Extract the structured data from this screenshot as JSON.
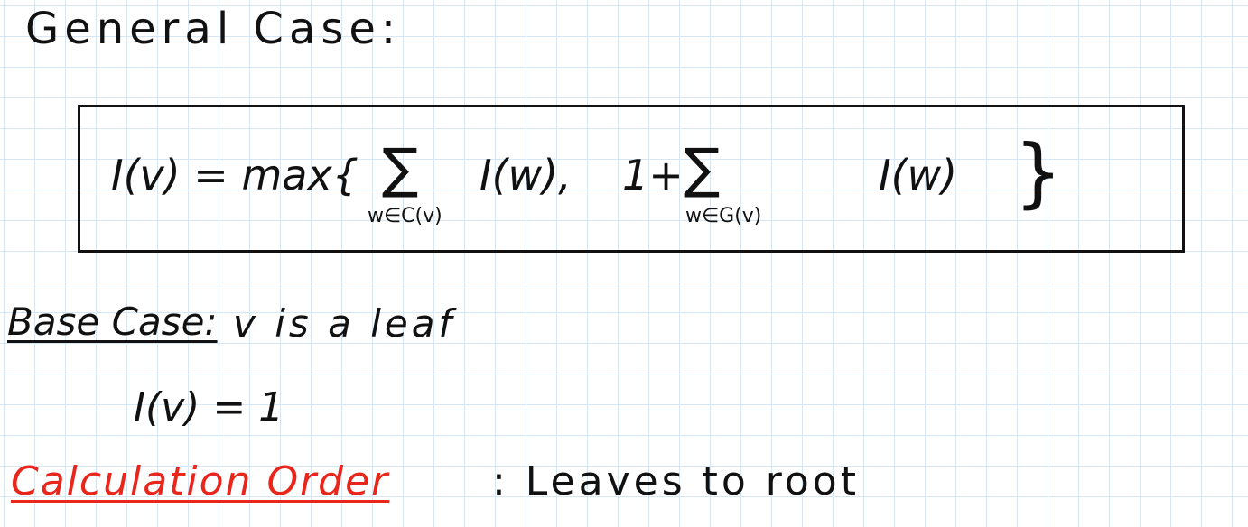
{
  "note": {
    "heading": "General Case:",
    "formula": {
      "lhs": "I(v) = max{",
      "sum1_sub": "w∈C(v)",
      "term1": "I(w),",
      "plus": "1+",
      "sum2_sub": "w∈G(v)",
      "term2": "I(w)",
      "close": "}"
    },
    "base_case_label": "Base Case:",
    "base_case_condition": "v is a leaf",
    "base_case_value": "I(v) = 1",
    "calc_order_label": "Calculation Order",
    "calc_order_value": ": Leaves to root"
  },
  "colors": {
    "ink": "#111111",
    "highlight_red": "#e8261c",
    "grid": "#d6e6f5"
  }
}
